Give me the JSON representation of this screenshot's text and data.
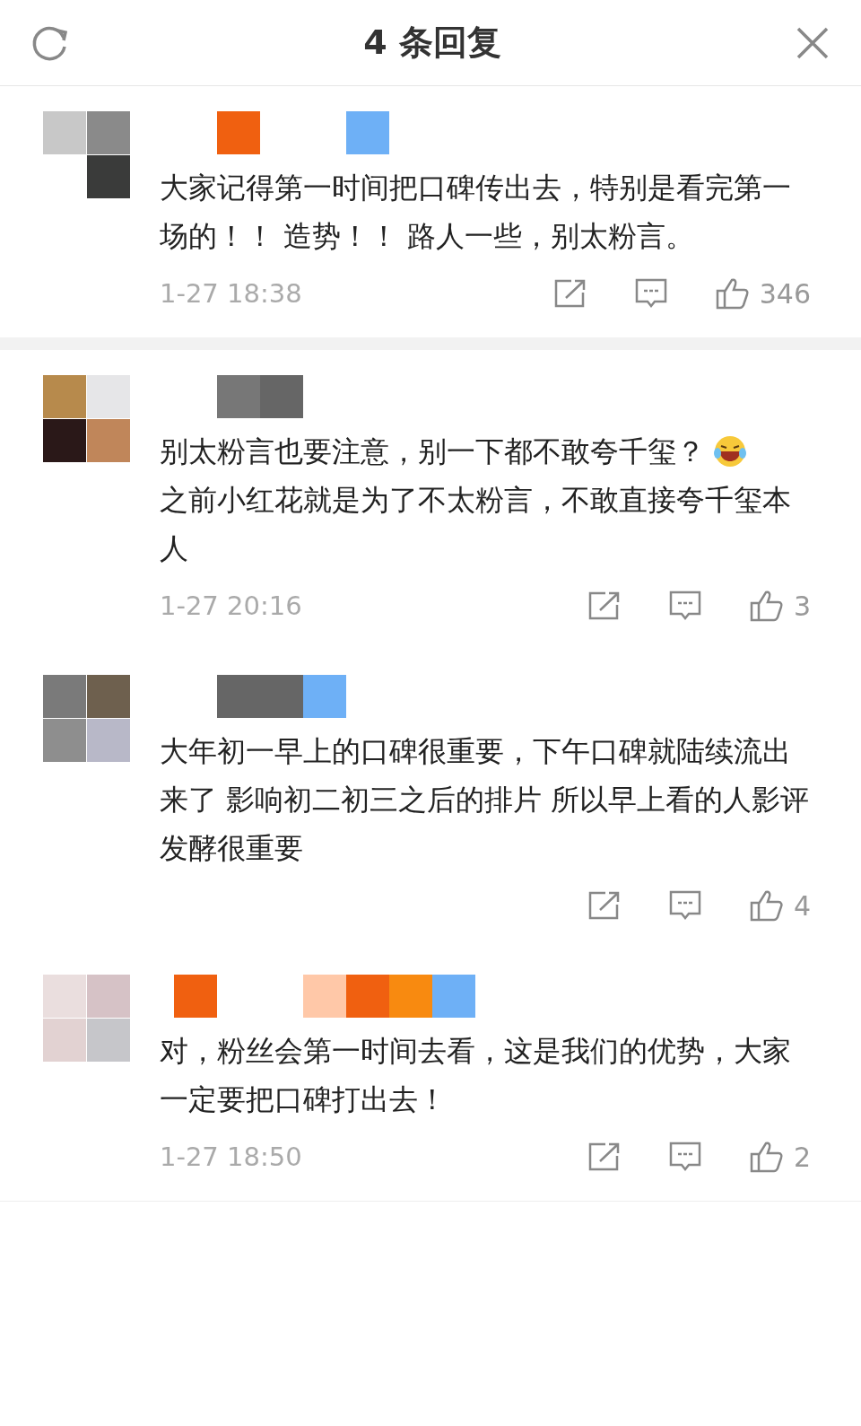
{
  "header": {
    "title": "4 条回复"
  },
  "comments": [
    {
      "text": [
        "大家记得第一时间把口碑传出去，特别是看完第一场的！！ 造势！！ 路人一些，别太粉言。"
      ],
      "emoji": false,
      "time": "1-27 18:38",
      "likes": "346"
    },
    {
      "text": [
        "别太粉言也要注意，别一下都不敢夸千玺？",
        "之前小红花就是为了不太粉言，不敢直接夸千玺本人"
      ],
      "emoji": true,
      "time": "1-27 20:16",
      "likes": "3"
    },
    {
      "text": [
        "大年初一早上的口碑很重要，下午口碑就陆续流出来了 影响初二初三之后的排片 所以早上看的人影评发酵很重要"
      ],
      "emoji": false,
      "likes": "4"
    },
    {
      "text": [
        "对，粉丝会第一时间去看，这是我们的优势，大家一定要把口碑打出去！"
      ],
      "emoji": false,
      "time": "1-27 18:50",
      "likes": "2"
    }
  ]
}
